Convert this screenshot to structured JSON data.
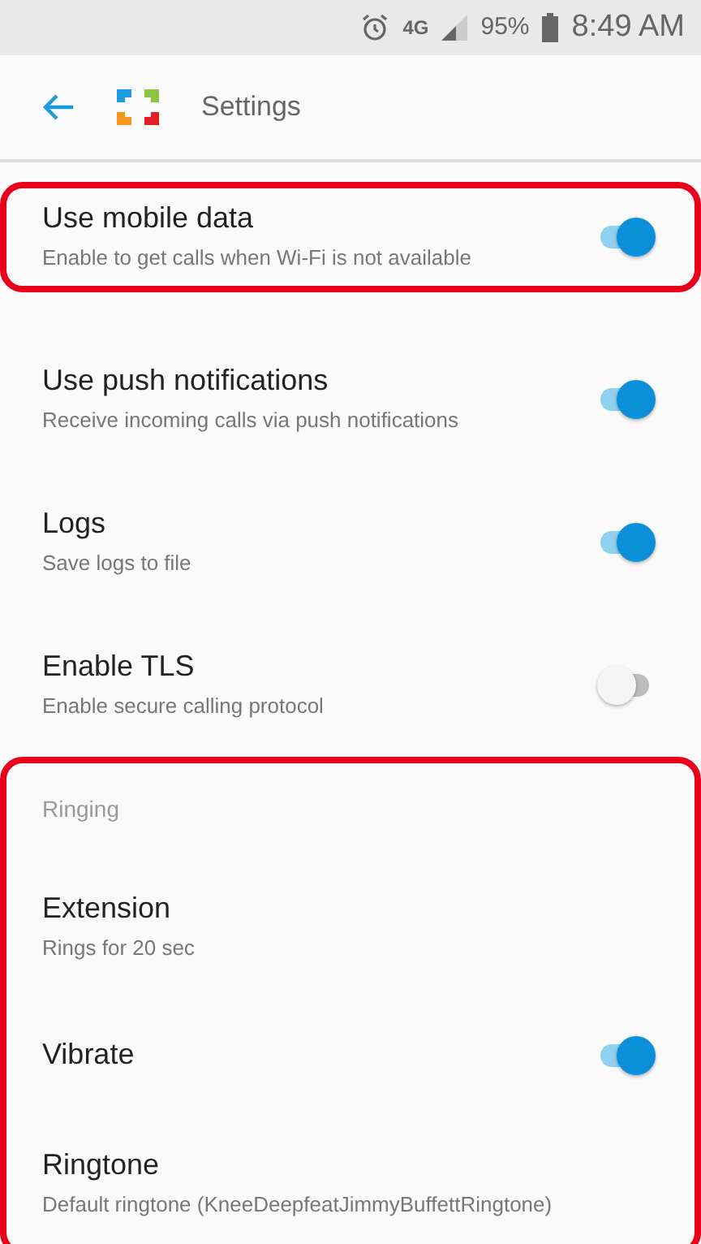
{
  "status_bar": {
    "network": "4G",
    "battery": "95%",
    "time": "8:49 AM"
  },
  "app_bar": {
    "title": "Settings"
  },
  "sections": [
    {
      "highlighted": false,
      "items": [
        {
          "kind": "toggle",
          "title": "Use mobile data",
          "subtitle": "Enable to get calls when Wi-Fi is not available",
          "on": true,
          "highlighted": true
        },
        {
          "kind": "toggle",
          "title": "Use push notifications",
          "subtitle": "Receive incoming calls via push notifications",
          "on": true,
          "highlighted": false
        },
        {
          "kind": "toggle",
          "title": "Logs",
          "subtitle": "Save logs to file",
          "on": true,
          "highlighted": false
        },
        {
          "kind": "toggle",
          "title": "Enable TLS",
          "subtitle": "Enable secure calling protocol",
          "on": false,
          "highlighted": false
        }
      ]
    },
    {
      "header": "Ringing",
      "highlighted": true,
      "items": [
        {
          "kind": "text",
          "title": "Extension",
          "subtitle": "Rings for 20 sec",
          "highlighted": false
        },
        {
          "kind": "toggle",
          "title": "Vibrate",
          "on": true,
          "highlighted": false
        },
        {
          "kind": "text",
          "title": "Ringtone",
          "subtitle": "Default ringtone (KneeDeepfeatJimmyBuffettRingtone)",
          "highlighted": false
        }
      ]
    }
  ]
}
